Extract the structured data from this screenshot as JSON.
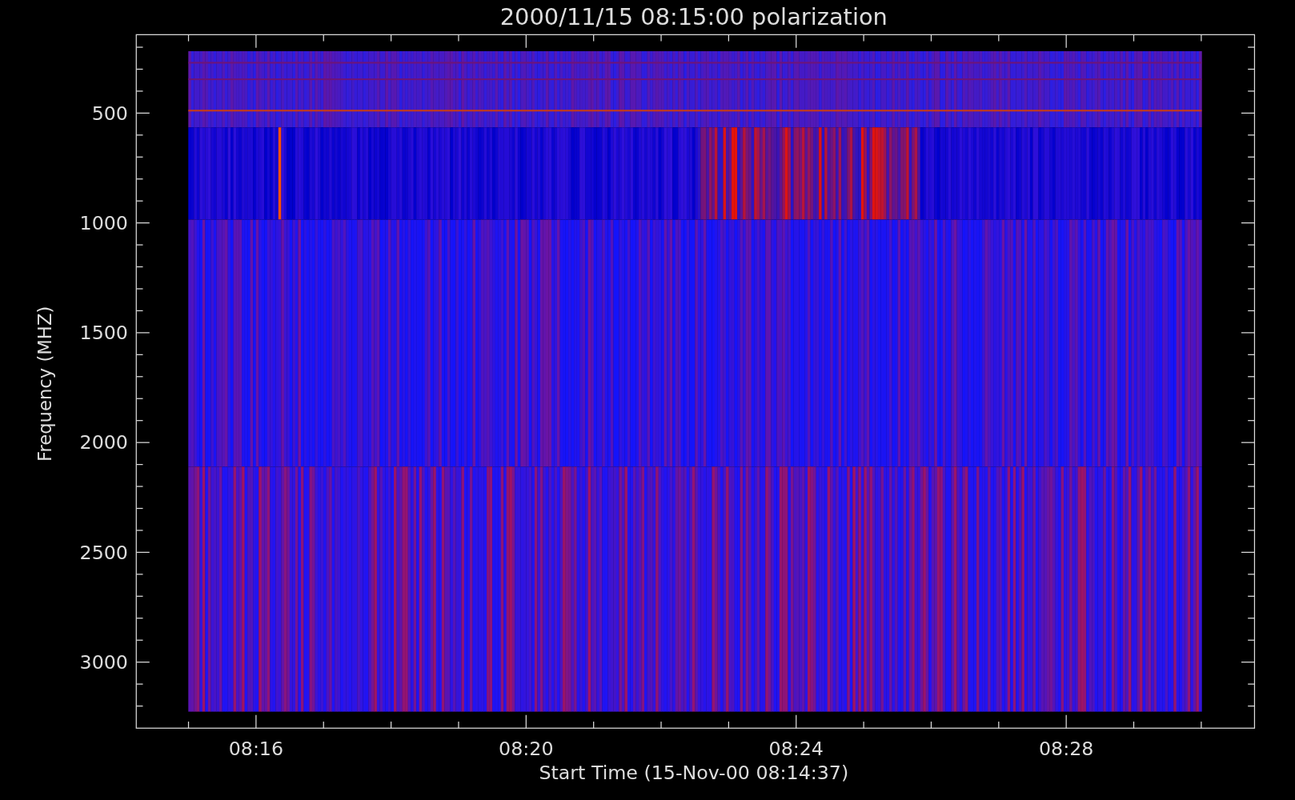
{
  "title": "2000/11/15 08:15:00 polarization",
  "y_axis": {
    "label": "Frequency (MHZ)",
    "ticks": [
      "500",
      "1000",
      "1500",
      "2000",
      "2500",
      "3000"
    ]
  },
  "x_axis": {
    "label": "Start Time (15-Nov-00 08:14:37)",
    "ticks": [
      "08:16",
      "08:20",
      "08:24",
      "08:28"
    ]
  }
}
